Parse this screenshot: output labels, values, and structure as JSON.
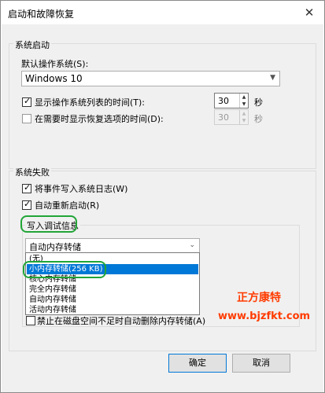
{
  "window": {
    "title": "启动和故障恢复",
    "close_symbol": "✕"
  },
  "system_startup": {
    "group_label": "系统启动",
    "default_os_label": "默认操作系统(S):",
    "default_os_value": "Windows 10",
    "show_os_list_label": "显示操作系统列表的时间(T):",
    "show_os_list_checked": true,
    "show_os_list_value": "30",
    "show_recovery_label": "在需要时显示恢复选项的时间(D):",
    "show_recovery_checked": false,
    "show_recovery_value": "30",
    "seconds_unit": "秒"
  },
  "system_failure": {
    "group_label": "系统失败",
    "write_event_label": "将事件写入系统日志(W)",
    "write_event_checked": true,
    "auto_restart_label": "自动重新启动(R)",
    "auto_restart_checked": true,
    "debug_info": {
      "group_label": "写入调试信息",
      "selected_value": "自动内存转储",
      "options": [
        "(无)",
        "小内存转储(256 KB)",
        "核心内存转储",
        "完全内存转储",
        "自动内存转储",
        "活动内存转储"
      ],
      "highlighted_index": 1
    },
    "disable_auto_delete_label": "禁止在磁盘空间不足时自动删除内存转储(A)",
    "disable_auto_delete_checked": false
  },
  "watermark": {
    "name": "正方康特",
    "url": "www.bjzfkt.com"
  },
  "buttons": {
    "ok": "确定",
    "cancel": "取消"
  },
  "colors": {
    "selection": "#0078d7",
    "annotation_oval": "#21a537",
    "watermark": "#ff3b00"
  }
}
